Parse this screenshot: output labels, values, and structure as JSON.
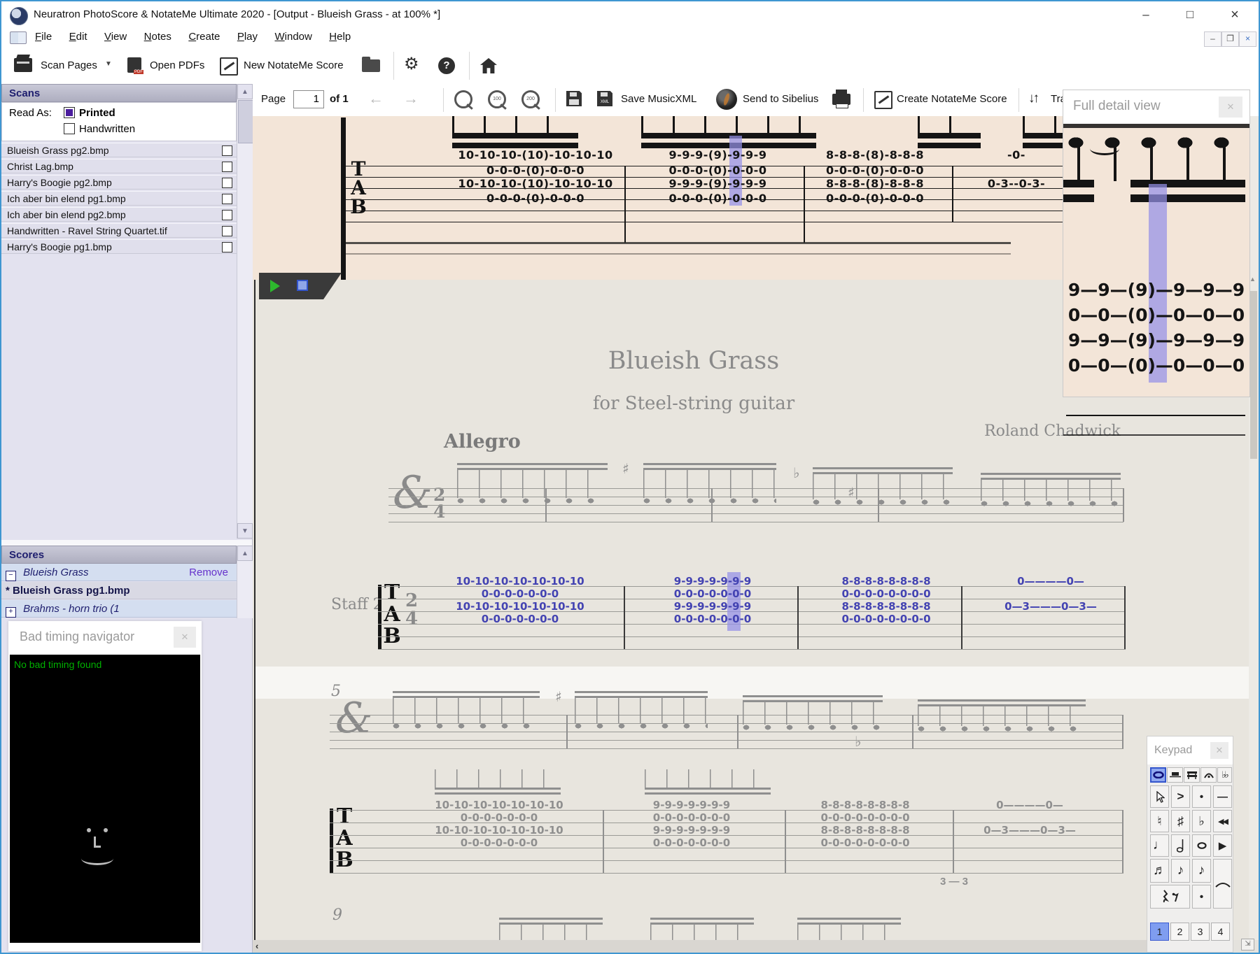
{
  "window": {
    "title": "Neuratron PhotoScore & NotateMe Ultimate 2020 - [Output - Blueish Grass - at 100% *]",
    "minimize": "–",
    "maximize": "□",
    "close": "×"
  },
  "menu": {
    "items": [
      "File",
      "Edit",
      "View",
      "Notes",
      "Create",
      "Play",
      "Window",
      "Help"
    ]
  },
  "toolbar": {
    "scan_pages": "Scan Pages",
    "open_pdfs": "Open PDFs",
    "new_notateme_score": "New NotateMe Score"
  },
  "nav_toolbar": {
    "page_label": "Page",
    "page_value": "1",
    "page_of": "of 1",
    "save_musicxml": "Save MusicXML",
    "send_to_sibelius": "Send to Sibelius",
    "create_notateme_score": "Create NotateMe Score",
    "transpose_label": "Tra"
  },
  "scans_panel": {
    "title": "Scans",
    "read_as_label": "Read As:",
    "printed_label": "Printed",
    "handwritten_label": "Handwritten",
    "printed_checked": true,
    "handwritten_checked": false,
    "files": [
      "Blueish Grass pg2.bmp",
      "Christ Lag.bmp",
      "Harry's Boogie pg2.bmp",
      "Ich aber bin elend pg1.bmp",
      "Ich aber bin elend pg2.bmp",
      "Handwritten - Ravel String Quartet.tif",
      "Harry's Boogie pg1.bmp"
    ]
  },
  "scores_panel": {
    "title": "Scores",
    "score_name": "Blueish Grass",
    "remove_label": "Remove",
    "page_item": "* Blueish Grass pg1.bmp",
    "other_score": "Brahms - horn trio (1"
  },
  "bad_timing_panel": {
    "title": "Bad timing navigator",
    "message": "No bad timing found"
  },
  "full_detail_panel": {
    "title": "Full detail view"
  },
  "keypad_panel": {
    "title": "Keypad",
    "pages": [
      "1",
      "2",
      "3",
      "4"
    ],
    "active_page": "1"
  },
  "score": {
    "title": "Blueish Grass",
    "subtitle": "for Steel-string guitar",
    "composer": "Roland Chadwick",
    "tempo": "Allegro",
    "staff_label": "Staff 2",
    "time_signature_top": "2",
    "time_signature_bottom": "4",
    "measure_number_5": "5",
    "measure_number_9": "9",
    "tab_clef": "TAB",
    "extra_tab_numbers": "3 — 3"
  },
  "tabs": {
    "scan": [
      [
        "10-10-10-(10)-10-10-10",
        "0-0-0-(0)-0-0-0",
        "10-10-10-(10)-10-10-10",
        "0-0-0-(0)-0-0-0"
      ],
      [
        "9-9-9-(9)-9-9-9",
        "0-0-0-(0)-0-0-0",
        "9-9-9-(9)-9-9-9",
        "0-0-0-(0)-0-0-0"
      ],
      [
        "8-8-8-(8)-8-8-8",
        "0-0-0-(0)-0-0-0",
        "8-8-8-(8)-8-8-8",
        "0-0-0-(0)-0-0-0"
      ],
      [
        "-0-",
        "",
        "0-3--0-3-",
        ""
      ]
    ],
    "out1": [
      [
        "10-10-10-10-10-10-10",
        "0-0-0-0-0-0-0",
        "10-10-10-10-10-10-10",
        "0-0-0-0-0-0-0"
      ],
      [
        "9-9-9-9-9-9-9",
        "0-0-0-0-0-0-0",
        "9-9-9-9-9-9-9",
        "0-0-0-0-0-0-0"
      ],
      [
        "8-8-8-8-8-8-8-8",
        "0-0-0-0-0-0-0-0",
        "8-8-8-8-8-8-8-8",
        "0-0-0-0-0-0-0-0"
      ],
      [
        "0————0—",
        "",
        "0—3———0—3—",
        ""
      ]
    ],
    "out2": [
      [
        "10-10-10-10-10-10-10",
        "0-0-0-0-0-0-0",
        "10-10-10-10-10-10-10",
        "0-0-0-0-0-0-0"
      ],
      [
        "9-9-9-9-9-9-9",
        "0-0-0-0-0-0-0",
        "9-9-9-9-9-9-9",
        "0-0-0-0-0-0-0"
      ],
      [
        "8-8-8-8-8-8-8-8",
        "0-0-0-0-0-0-0-0",
        "8-8-8-8-8-8-8-8",
        "0-0-0-0-0-0-0-0"
      ],
      [
        "0————0—",
        "",
        "0—3———0—3—",
        ""
      ]
    ],
    "detail": [
      "9—9—(9)—9—9—9",
      "0—0—(0)—0—0—0",
      "9—9—(9)—9—9—9",
      "0—0—(0)—0—0—0"
    ]
  },
  "colors": {
    "window_border": "#3f96d1",
    "sidebar_bg": "#e3e2ef",
    "panel_header_bg": "#b7b7c9",
    "panel_header_text": "#1e1e6e",
    "scan_paper": "#f3e5d8",
    "output_paper": "#e8e5de",
    "tab_numbers_blue": "#4343b2",
    "tab_numbers_gray": "#8f8f8f",
    "selection_highlight": "#9490e8",
    "printed_checkbox": "#4b1d9e",
    "remove_link": "#6633cc",
    "bad_timing_text": "#00b000",
    "keypad_selected": "#8fa8ef"
  }
}
